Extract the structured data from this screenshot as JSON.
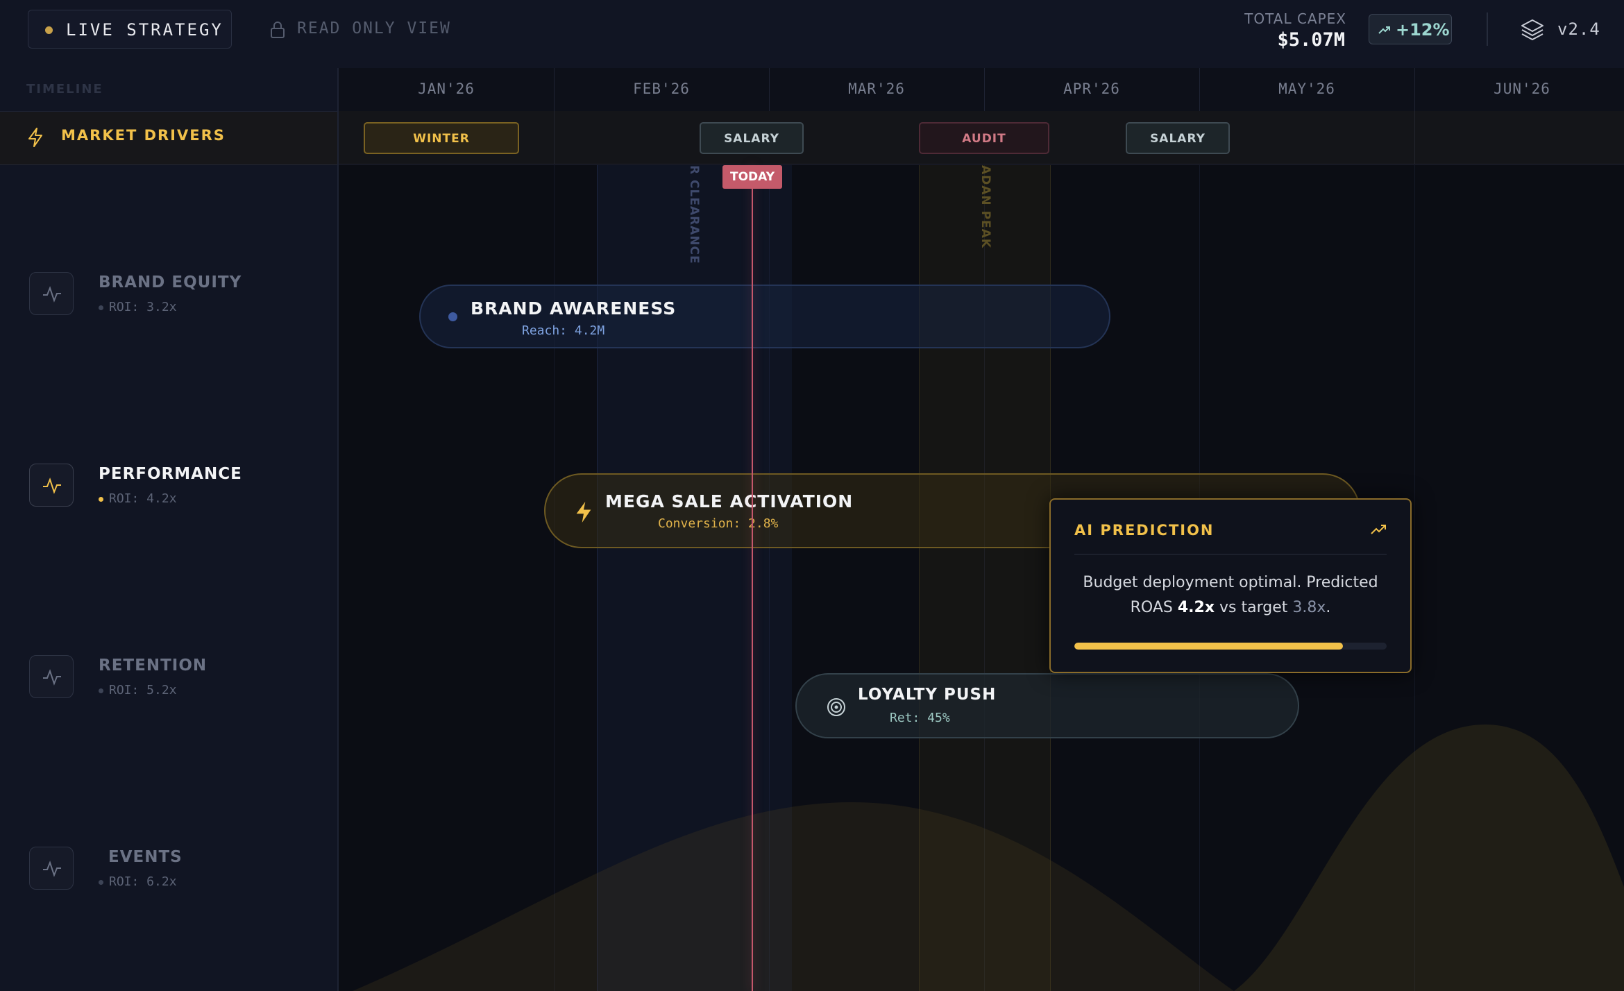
{
  "header": {
    "live_label": "LIVE STRATEGY",
    "readonly_label": "READ ONLY VIEW",
    "capex_label": "TOTAL CAPEX",
    "capex_value": "$5.07M",
    "delta": "+12%",
    "version": "v2.4"
  },
  "timeline": {
    "label": "TIMELINE",
    "months": [
      "JAN'26",
      "FEB'26",
      "MAR'26",
      "APR'26",
      "MAY'26",
      "JUN'26"
    ],
    "today_label": "TODAY"
  },
  "drivers": {
    "label": "MARKET DRIVERS",
    "chips": [
      "WINTER",
      "SALARY",
      "AUDIT",
      "SALARY"
    ]
  },
  "bands": {
    "blue_label": "R CLEARANCE",
    "gold_label": "ADAN PEAK"
  },
  "categories": [
    {
      "name": "BRAND EQUITY",
      "roi": "ROI: 3.2x"
    },
    {
      "name": "PERFORMANCE",
      "roi": "ROI: 4.2x"
    },
    {
      "name": "RETENTION",
      "roi": "ROI: 5.2x"
    },
    {
      "name": "EVENTS",
      "roi": "ROI: 6.2x"
    }
  ],
  "campaigns": {
    "brand": {
      "title": "BRAND AWARENESS",
      "metric": "Reach: 4.2M"
    },
    "mega": {
      "title": "MEGA SALE ACTIVATION",
      "metric": "Conversion: 2.8%"
    },
    "loyalty": {
      "title": "LOYALTY PUSH",
      "metric": "Ret: 45%"
    }
  },
  "ai": {
    "title": "AI PREDICTION",
    "text_before": "Budget deployment optimal. Predicted ROAS ",
    "roas": "4.2x",
    "text_mid": " vs target ",
    "target": "3.8x",
    "text_end": ".",
    "progress": 0.86
  },
  "colors": {
    "accent_gold": "#f2c14a",
    "today_red": "#c45a6a",
    "teal": "#9cd6cf"
  }
}
